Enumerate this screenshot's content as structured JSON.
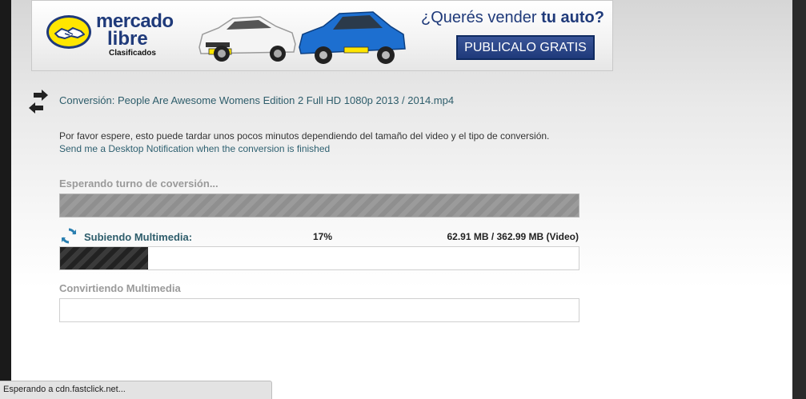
{
  "banner": {
    "brand_line1": "mercado",
    "brand_line2": "libre",
    "brand_sub": "Clasificados",
    "question_prefix": "¿Querés vender ",
    "question_bold": "tu auto?",
    "cta_label": "PUBLICALO GRATIS",
    "accent_color": "#1f3a7a",
    "logo_color": "#ffe600"
  },
  "conversion": {
    "title": "Conversión: People Are Awesome Womens Edition 2 Full HD 1080p 2013 / 2014.mp4",
    "title_icon": "swap-arrows-icon",
    "wait_text": "Por favor espere, esto puede tardar unos pocos minutos dependiendo del tamaño del video y el tipo de conversión.",
    "notify_link": "Send me a Desktop Notification when the conversion is finished"
  },
  "steps": {
    "waiting": {
      "label": "Esperando turno de coversión...",
      "progress": 1.0
    },
    "uploading": {
      "icon": "refresh-icon",
      "label": "Subiendo Multimedia:",
      "percent_text": "17%",
      "size_text": "62.91 MB / 362.99 MB (Video)",
      "progress": 0.17
    },
    "converting": {
      "label": "Convirtiendo Multimedia",
      "progress": 0.0
    }
  },
  "statusbar": {
    "text": "Esperando a cdn.fastclick.net..."
  }
}
